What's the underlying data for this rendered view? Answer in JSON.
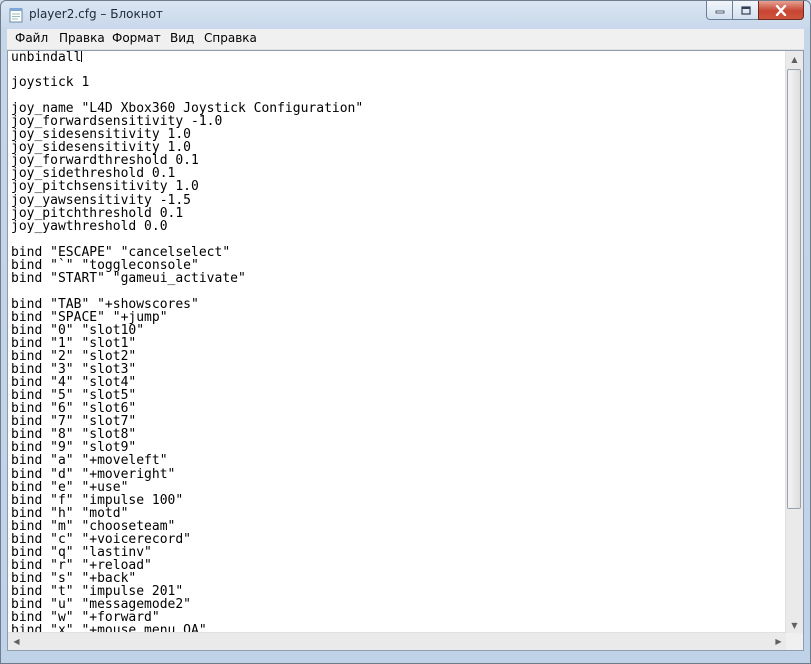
{
  "window": {
    "title": "player2.cfg – Блокнот"
  },
  "menu": {
    "items": [
      "Файл",
      "Правка",
      "Формат",
      "Вид",
      "Справка"
    ]
  },
  "editor": {
    "lines": [
      "unbindall",
      "",
      "joystick 1",
      "",
      "joy_name \"L4D Xbox360 Joystick Configuration\"",
      "joy_forwardsensitivity -1.0",
      "joy_sidesensitivity 1.0",
      "joy_sidesensitivity 1.0",
      "joy_forwardthreshold 0.1",
      "joy_sidethreshold 0.1",
      "joy_pitchsensitivity 1.0",
      "joy_yawsensitivity -1.5",
      "joy_pitchthreshold 0.1",
      "joy_yawthreshold 0.0",
      "",
      "bind \"ESCAPE\" \"cancelselect\"",
      "bind \"`\" \"toggleconsole\"",
      "bind \"START\" \"gameui_activate\"",
      "",
      "bind \"TAB\" \"+showscores\"",
      "bind \"SPACE\" \"+jump\"",
      "bind \"0\" \"slot10\"",
      "bind \"1\" \"slot1\"",
      "bind \"2\" \"slot2\"",
      "bind \"3\" \"slot3\"",
      "bind \"4\" \"slot4\"",
      "bind \"5\" \"slot5\"",
      "bind \"6\" \"slot6\"",
      "bind \"7\" \"slot7\"",
      "bind \"8\" \"slot8\"",
      "bind \"9\" \"slot9\"",
      "bind \"a\" \"+moveleft\"",
      "bind \"d\" \"+moveright\"",
      "bind \"e\" \"+use\"",
      "bind \"f\" \"impulse 100\"",
      "bind \"h\" \"motd\"",
      "bind \"m\" \"chooseteam\"",
      "bind \"c\" \"+voicerecord\"",
      "bind \"q\" \"lastinv\"",
      "bind \"r\" \"+reload\"",
      "bind \"s\" \"+back\"",
      "bind \"t\" \"impulse 201\"",
      "bind \"u\" \"messagemode2\"",
      "bind \"w\" \"+forward\"",
      "bind \"x\" \"+mouse_menu QA\""
    ]
  },
  "colors": {
    "titlebar": "#c6d6e9",
    "close_button": "#c74532",
    "editor_bg": "#ffffff"
  }
}
